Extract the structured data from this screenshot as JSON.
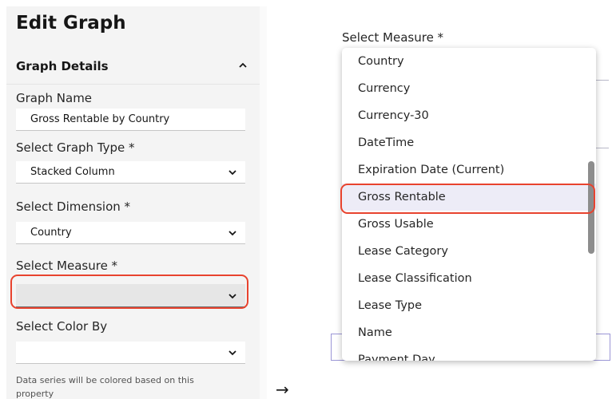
{
  "editor": {
    "title": "Edit Graph",
    "section_title": "Graph Details",
    "graph_name": {
      "label": "Graph Name",
      "value": "Gross Rentable by Country"
    },
    "graph_type": {
      "label": "Select Graph Type *",
      "value": "Stacked Column"
    },
    "dimension": {
      "label": "Select Dimension  *",
      "value": "Country"
    },
    "measure": {
      "label": "Select Measure  *",
      "value": ""
    },
    "color_by": {
      "label": "Select Color By",
      "value": "",
      "helper": "Data series will be colored based on this property"
    }
  },
  "arrow": "→",
  "measure_dropdown": {
    "label": "Select Measure  *",
    "options": [
      "Country",
      "Currency",
      "Currency-30",
      "DateTime",
      "Expiration Date (Current)",
      "Gross Rentable",
      "Gross Usable",
      "Lease Category",
      "Lease Classification",
      "Lease Type",
      "Name",
      "Payment Day"
    ],
    "highlighted_option": "Gross Rentable"
  },
  "colors": {
    "highlight": "#e8432e",
    "selected_bg": "#edecf7",
    "panel_bg": "#f4f4f4"
  }
}
